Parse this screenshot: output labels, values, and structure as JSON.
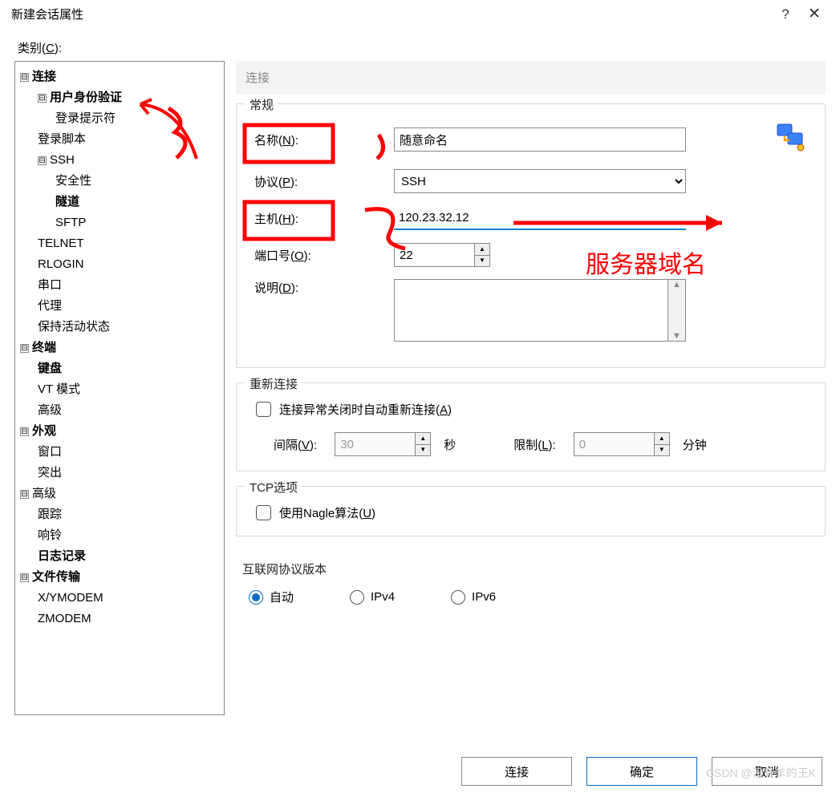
{
  "window": {
    "title": "新建会话属性",
    "help_symbol": "?",
    "close_symbol": "✕"
  },
  "category_label_prefix": "类别(",
  "category_label_u": "C",
  "category_label_suffix": "):",
  "tree": {
    "connection": "连接",
    "auth": "用户身份验证",
    "login_prompt": "登录提示符",
    "login_script": "登录脚本",
    "ssh": "SSH",
    "security": "安全性",
    "tunnel": "隧道",
    "sftp": "SFTP",
    "telnet": "TELNET",
    "rlogin": "RLOGIN",
    "serial": "串口",
    "proxy": "代理",
    "keepalive": "保持活动状态",
    "terminal": "终端",
    "keyboard": "键盘",
    "vtmode": "VT 模式",
    "advanced_term": "高级",
    "appearance": "外观",
    "window": "窗口",
    "highlight": "突出",
    "advanced": "高级",
    "trace": "跟踪",
    "bell": "响铃",
    "log": "日志记录",
    "file_transfer": "文件传输",
    "xymodem": "X/YMODEM",
    "zmodem": "ZMODEM",
    "minus": "⊟"
  },
  "section_header": "连接",
  "group_general": "常规",
  "labels": {
    "name": "名称(",
    "name_u": "N",
    "suffix": "):",
    "protocol": "协议(",
    "protocol_u": "P",
    "host": "主机(",
    "host_u": "H",
    "port": "端口号(",
    "port_u": "O",
    "desc": "说明(",
    "desc_u": "D"
  },
  "fields": {
    "name_value": "随意命名",
    "protocol_value": "SSH",
    "host_value": "120.23.32.12",
    "port_value": "22",
    "desc_value": ""
  },
  "group_reconnect": "重新连接",
  "reconnect": {
    "checkbox": "连接异常关闭时自动重新连接(",
    "checkbox_u": "A",
    "checkbox_suffix": ")",
    "interval": "间隔(",
    "interval_u": "V",
    "interval_val": "30",
    "sec": "秒",
    "limit": "限制(",
    "limit_u": "L",
    "limit_val": "0",
    "min": "分钟"
  },
  "group_tcp": "TCP选项",
  "tcp": {
    "nagle": "使用Nagle算法(",
    "nagle_u": "U",
    "nagle_suffix": ")"
  },
  "group_ip": "互联网协议版本",
  "ip": {
    "auto": "自动",
    "ipv4": "IPv4",
    "ipv6": "IPv6"
  },
  "buttons": {
    "connect": "连接",
    "ok": "确定",
    "cancel": "取消"
  },
  "watermark": "CSDN @没有羊的王K",
  "annotations": {
    "server_domain": "服务器域名"
  }
}
